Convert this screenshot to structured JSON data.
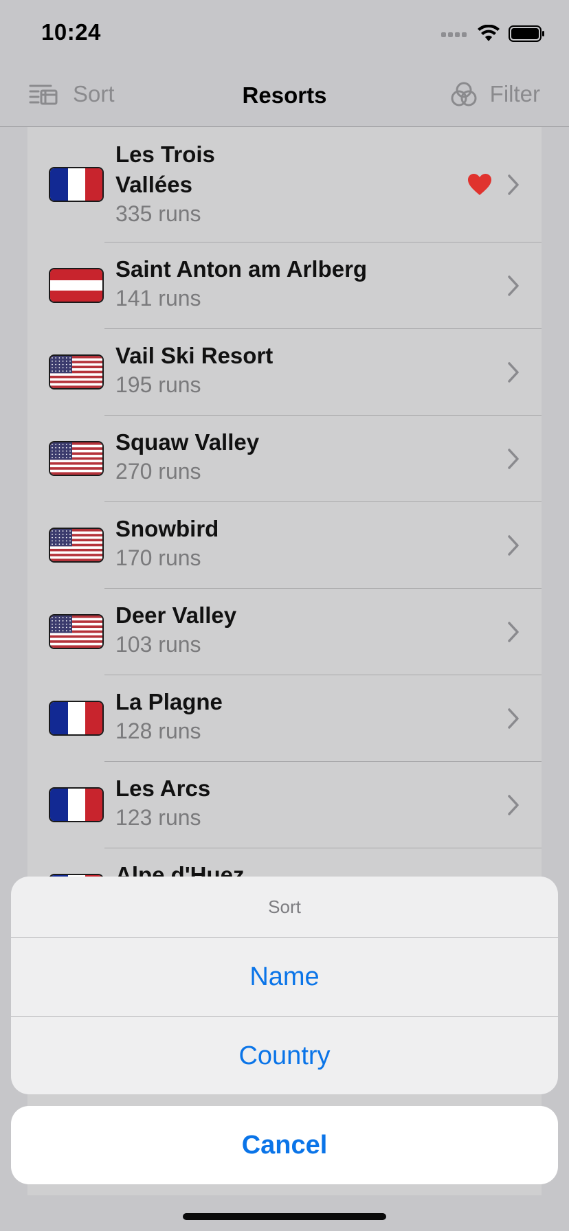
{
  "status_bar": {
    "time": "10:24"
  },
  "nav": {
    "sort_label": "Sort",
    "title": "Resorts",
    "filter_label": "Filter"
  },
  "resorts": [
    {
      "name_line1": "Les Trois",
      "name_line2": "Vallées",
      "runs": "335 runs",
      "country": "France",
      "favorite": true
    },
    {
      "name": "Saint Anton am Arlberg",
      "runs": "141 runs",
      "country": "Austria"
    },
    {
      "name": "Vail Ski Resort",
      "runs": "195 runs",
      "country": "USA"
    },
    {
      "name": "Squaw Valley",
      "runs": "270 runs",
      "country": "USA"
    },
    {
      "name": "Snowbird",
      "runs": "170 runs",
      "country": "USA"
    },
    {
      "name": "Deer Valley",
      "runs": "103 runs",
      "country": "USA"
    },
    {
      "name": "La Plagne",
      "runs": "128 runs",
      "country": "France"
    },
    {
      "name": "Les Arcs",
      "runs": "123 runs",
      "country": "France"
    },
    {
      "name": "Alpe d'Huez",
      "country": "France"
    }
  ],
  "action_sheet": {
    "title": "Sort",
    "options": [
      "Name",
      "Country"
    ],
    "cancel": "Cancel"
  },
  "colors": {
    "accent": "#0a74e8",
    "heart": "#e0332e"
  },
  "icons": [
    "sort-icon",
    "filter-icon",
    "chevron-right-icon",
    "heart-icon",
    "flag-france-icon",
    "flag-austria-icon",
    "flag-usa-icon"
  ]
}
